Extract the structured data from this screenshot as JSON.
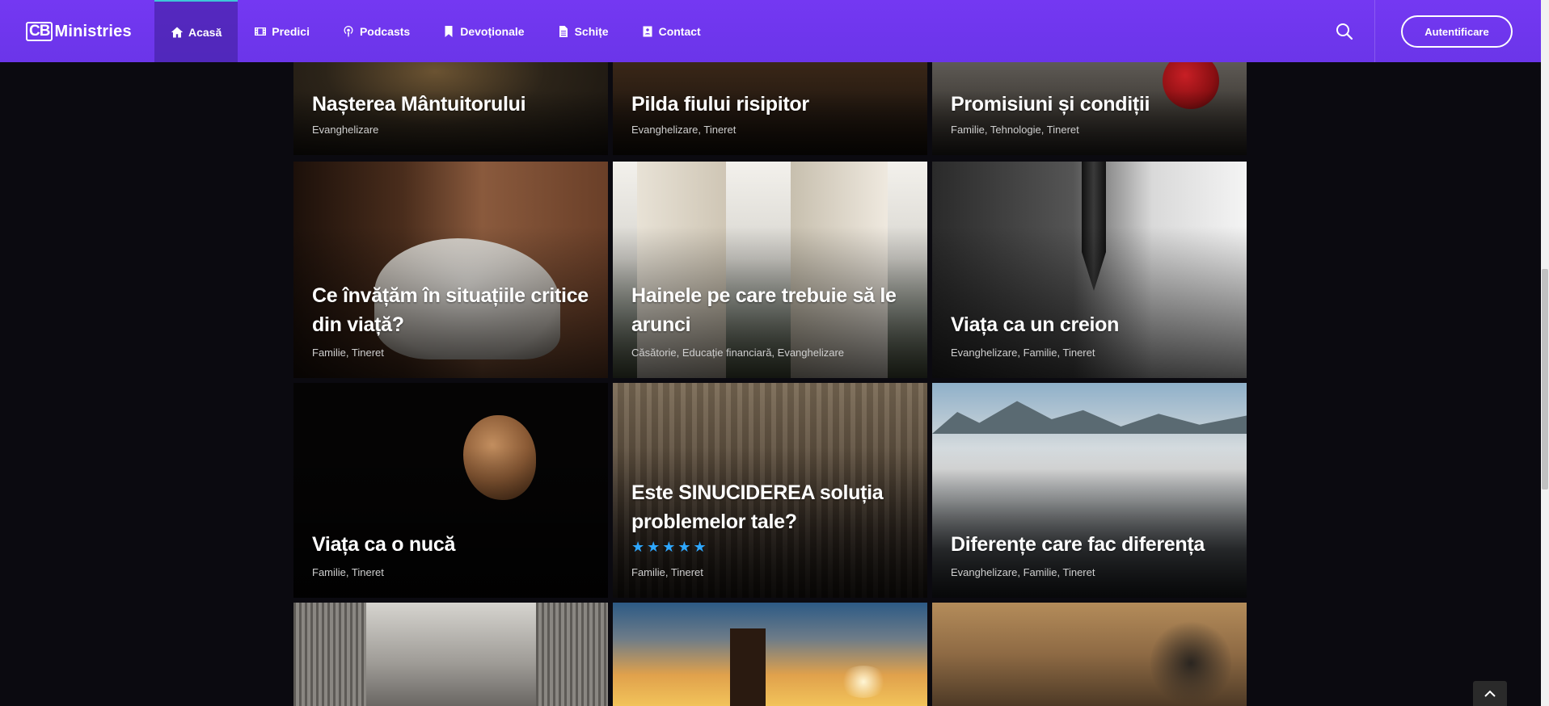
{
  "header": {
    "logo_box": "CB",
    "logo_text": "Ministries",
    "nav": [
      {
        "label": "Acasă",
        "icon": "home-icon"
      },
      {
        "label": "Predici",
        "icon": "film-icon"
      },
      {
        "label": "Podcasts",
        "icon": "podcast-icon"
      },
      {
        "label": "Devoționale",
        "icon": "bookmark-icon"
      },
      {
        "label": "Schițe",
        "icon": "file-icon"
      },
      {
        "label": "Contact",
        "icon": "contact-icon"
      }
    ],
    "login_label": "Autentificare"
  },
  "colors": {
    "header": "#7438f2",
    "active_border": "#3ec6d9",
    "star": "#2ea7ff",
    "page_bg": "#0b0a10"
  },
  "cards": [
    {
      "title": "Nașterea Mântuitorului",
      "cats": "Evanghelizare"
    },
    {
      "title": "Pilda fiului risipitor",
      "cats": "Evanghelizare, Tineret"
    },
    {
      "title": "Promisiuni și condiții",
      "cats": "Familie, Tehnologie, Tineret"
    },
    {
      "title": "Ce învățăm în situațiile critice din viață?",
      "cats": "Familie, Tineret"
    },
    {
      "title": "Hainele pe care trebuie să le arunci",
      "cats": "Căsătorie, Educație financiară, Evanghelizare"
    },
    {
      "title": "Viața ca un creion",
      "cats": "Evanghelizare, Familie, Tineret"
    },
    {
      "title": "Viața ca o nucă",
      "cats": "Familie, Tineret"
    },
    {
      "title": "Este SINUCIDEREA soluția problemelor tale?",
      "cats": "Familie, Tineret",
      "rating": 5
    },
    {
      "title": "Diferențe care fac diferența",
      "cats": "Evanghelizare, Familie, Tineret"
    },
    {
      "title": "",
      "cats": ""
    },
    {
      "title": "",
      "cats": ""
    },
    {
      "title": "",
      "cats": ""
    }
  ]
}
